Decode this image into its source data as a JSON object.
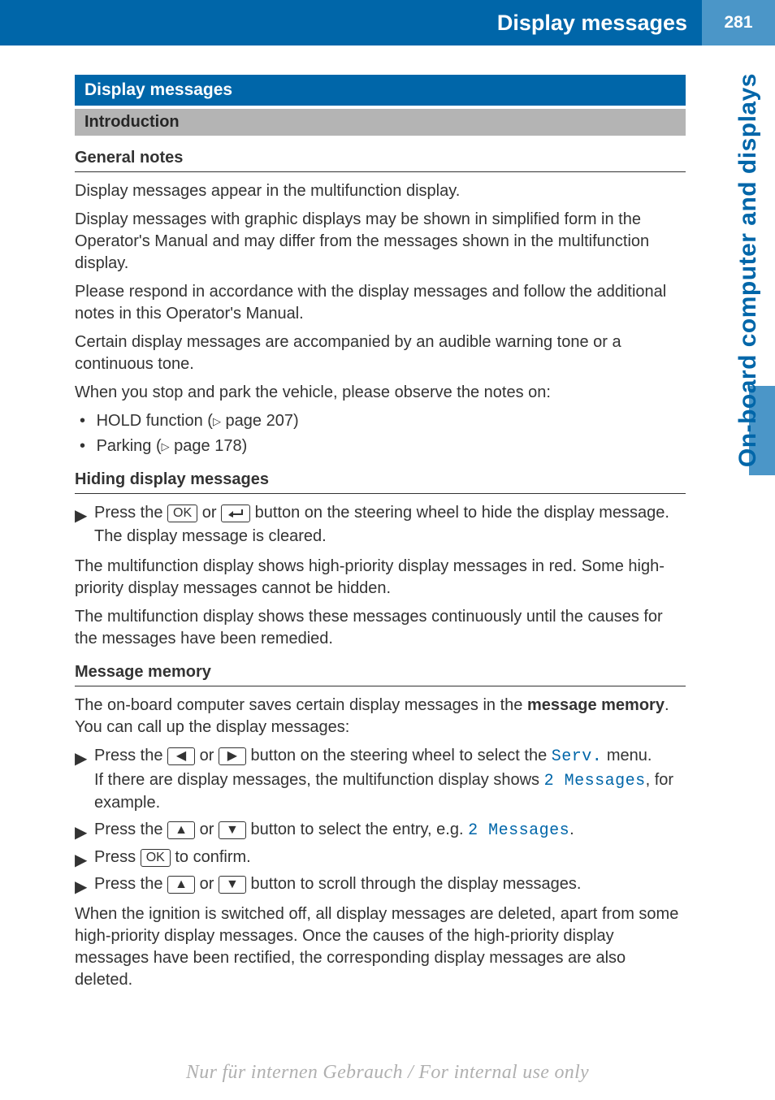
{
  "header": {
    "title": "Display messages",
    "page_number": "281"
  },
  "side_tab": "On-board computer and displays",
  "sections": {
    "main_title": "Display messages",
    "sub_title": "Introduction",
    "general_notes": {
      "heading": "General notes",
      "p1": "Display messages appear in the multifunction display.",
      "p2": "Display messages with graphic displays may be shown in simplified form in the Operator's Manual and may differ from the messages shown in the multifunction display.",
      "p3": "Please respond in accordance with the display messages and follow the additional notes in this Operator's Manual.",
      "p4": "Certain display messages are accompanied by an audible warning tone or a continuous tone.",
      "p5": "When you stop and park the vehicle, please observe the notes on:",
      "bullets": {
        "b1_pre": "HOLD function (",
        "b1_page": " page 207)",
        "b2_pre": "Parking (",
        "b2_page": " page 178)"
      }
    },
    "hiding": {
      "heading": "Hiding display messages",
      "step1_a": "Press the ",
      "step1_b": " or ",
      "step1_c": " button on the steering wheel to hide the display message.",
      "step1_sub": "The display message is cleared.",
      "p1": "The multifunction display shows high-priority display messages in red. Some high-priority display messages cannot be hidden.",
      "p2": "The multifunction display shows these messages continuously until the causes for the messages have been remedied."
    },
    "memory": {
      "heading": "Message memory",
      "p1_a": "The on-board computer saves certain display messages in the ",
      "p1_strong": "message memory",
      "p1_b": ". You can call up the display messages:",
      "s1_a": "Press the ",
      "s1_b": " or ",
      "s1_c": " button on the steering wheel to select the ",
      "s1_disp": "Serv.",
      "s1_d": " menu.",
      "s1_sub_a": "If there are display messages, the multifunction display shows ",
      "s1_sub_disp": "2 Messages",
      "s1_sub_b": ", for example.",
      "s2_a": "Press the ",
      "s2_b": " or ",
      "s2_c": " button to select the entry, e.g. ",
      "s2_disp": "2 Messages",
      "s2_d": ".",
      "s3_a": "Press ",
      "s3_b": " to confirm.",
      "s4_a": "Press the ",
      "s4_b": " or ",
      "s4_c": " button to scroll through the display messages.",
      "p2": "When the ignition is switched off, all display messages are deleted, apart from some high-priority display messages. Once the causes of the high-priority display messages have been rectified, the corresponding display messages are also deleted."
    }
  },
  "keys": {
    "ok": "OK"
  },
  "watermark": "Nur für internen Gebrauch / For internal use only"
}
